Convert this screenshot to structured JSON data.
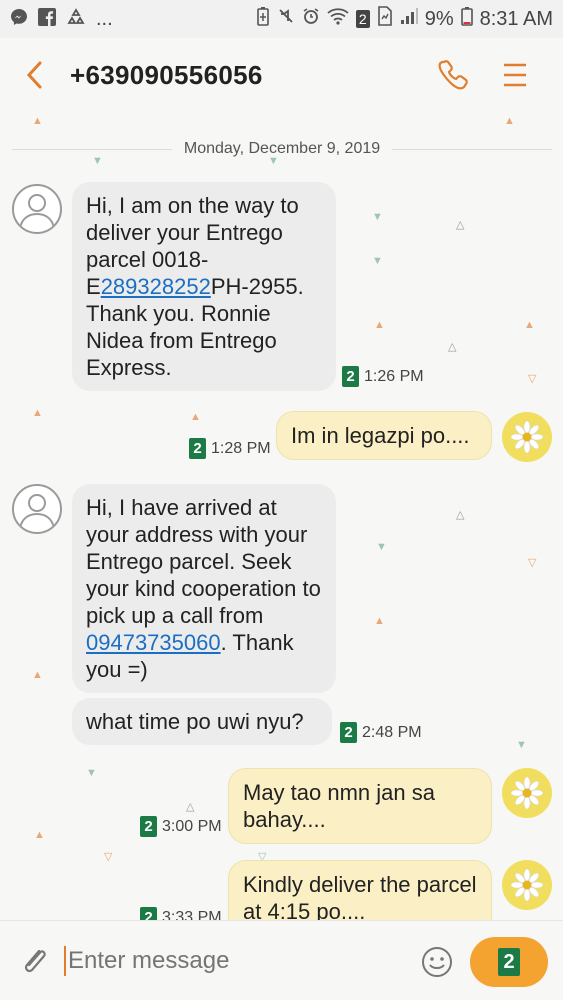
{
  "status_bar": {
    "left_icons": [
      "messenger-icon",
      "facebook-icon",
      "recycle-icon"
    ],
    "dots": "...",
    "sim_badge": "2",
    "battery": "9%",
    "time": "8:31 AM"
  },
  "header": {
    "contact": "+639090556056"
  },
  "thread": {
    "date": "Monday, December 9, 2019",
    "messages": [
      {
        "dir": "in",
        "text_before": "Hi, I am on the way to deliver your Entrego parcel 0018-E",
        "link": "289328252",
        "text_after": "PH-2955. Thank you. Ronnie Nidea from Entrego Express.",
        "sim": "2",
        "time": "1:26 PM"
      },
      {
        "dir": "out",
        "text": "Im in legazpi po....",
        "sim": "2",
        "time": "1:28 PM"
      },
      {
        "dir": "in",
        "text_before": "Hi, I have arrived at your address with your Entrego parcel. Seek your kind cooperation to pick up a call from ",
        "link": "09473735060",
        "text_after": ". Thank you =)"
      },
      {
        "dir": "in",
        "text": "what time po uwi nyu?",
        "sim": "2",
        "time": "2:48 PM"
      },
      {
        "dir": "out",
        "text": "May tao nmn jan sa bahay....",
        "sim": "2",
        "time": "3:00 PM"
      },
      {
        "dir": "out",
        "text": "Kindly deliver the parcel at 4:15 po....",
        "sim": "2",
        "time": "3:33 PM"
      }
    ]
  },
  "composer": {
    "placeholder": "Enter message",
    "send_sim": "2"
  },
  "colors": {
    "accent": "#e07d2e",
    "send": "#f4a330",
    "sim": "#1b7a45",
    "link": "#1a6fc2"
  }
}
